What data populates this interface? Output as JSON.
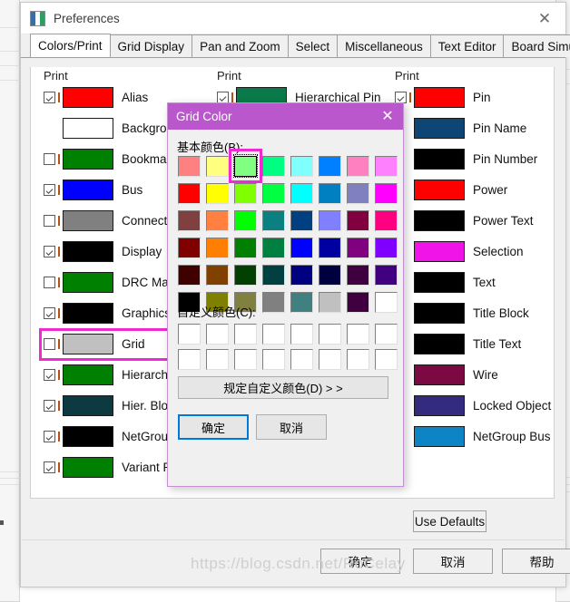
{
  "window": {
    "title": "Preferences",
    "close_label": "✕",
    "app_icon": "app-window-icon"
  },
  "tabs": [
    {
      "label": "Colors/Print",
      "active": true
    },
    {
      "label": "Grid Display",
      "active": false
    },
    {
      "label": "Pan and Zoom",
      "active": false
    },
    {
      "label": "Select",
      "active": false
    },
    {
      "label": "Miscellaneous",
      "active": false
    },
    {
      "label": "Text Editor",
      "active": false
    },
    {
      "label": "Board Simulation",
      "active": false
    }
  ],
  "columns": [
    {
      "header": "Print",
      "rows": [
        {
          "label": "Alias",
          "color": "#fe0000",
          "checked": true,
          "has_checkbox": true,
          "has_tick": true
        },
        {
          "label": "Background",
          "color": "#ffffff",
          "checked": false,
          "has_checkbox": false,
          "has_tick": false
        },
        {
          "label": "Bookmark",
          "color": "#008000",
          "checked": false,
          "has_checkbox": true,
          "has_tick": true
        },
        {
          "label": "Bus",
          "color": "#0000fe",
          "checked": true,
          "has_checkbox": true,
          "has_tick": true
        },
        {
          "label": "Connection S",
          "color": "#808080",
          "checked": false,
          "has_checkbox": true,
          "has_tick": true
        },
        {
          "label": "Display",
          "color": "#000000",
          "checked": true,
          "has_checkbox": true,
          "has_tick": true
        },
        {
          "label": "DRC Marker",
          "color": "#008000",
          "checked": false,
          "has_checkbox": true,
          "has_tick": true
        },
        {
          "label": "Graphics",
          "color": "#000000",
          "checked": true,
          "has_checkbox": true,
          "has_tick": true
        },
        {
          "label": "Grid",
          "color": "#c0c0c0",
          "checked": false,
          "has_checkbox": true,
          "has_tick": true,
          "highlighted": true
        },
        {
          "label": "Hierarchical",
          "color": "#008000",
          "checked": true,
          "has_checkbox": true,
          "has_tick": true
        },
        {
          "label": "Hier. Block N",
          "color": "#0c3a40",
          "checked": true,
          "has_checkbox": true,
          "has_tick": true
        },
        {
          "label": "NetGroup Bl",
          "color": "#000000",
          "checked": true,
          "has_checkbox": true,
          "has_tick": true
        },
        {
          "label": "Variant Part",
          "color": "#008000",
          "checked": true,
          "has_checkbox": true,
          "has_tick": true
        }
      ]
    },
    {
      "header": "Print",
      "rows": [
        {
          "label": "Hierarchical Pin",
          "color": "#0a7a4a",
          "checked": true,
          "has_checkbox": true,
          "has_tick": true
        }
      ]
    },
    {
      "header": "Print",
      "rows": [
        {
          "label": "Pin",
          "color": "#fe0000",
          "checked": true,
          "has_checkbox": true,
          "has_tick": true
        },
        {
          "label": "Pin Name",
          "color": "#0d4574",
          "checked": false,
          "has_checkbox": false,
          "has_tick": false
        },
        {
          "label": "Pin Number",
          "color": "#000000",
          "checked": false,
          "has_checkbox": false,
          "has_tick": false
        },
        {
          "label": "Power",
          "color": "#fe0000",
          "checked": false,
          "has_checkbox": false,
          "has_tick": false
        },
        {
          "label": "Power Text",
          "color": "#000000",
          "checked": false,
          "has_checkbox": false,
          "has_tick": false
        },
        {
          "label": "Selection",
          "color": "#f114e8",
          "checked": false,
          "has_checkbox": false,
          "has_tick": false
        },
        {
          "label": "Text",
          "color": "#000000",
          "checked": false,
          "has_checkbox": false,
          "has_tick": false
        },
        {
          "label": "Title Block",
          "color": "#000000",
          "checked": false,
          "has_checkbox": false,
          "has_tick": false
        },
        {
          "label": "Title Text",
          "color": "#000000",
          "checked": false,
          "has_checkbox": false,
          "has_tick": false
        },
        {
          "label": "Wire",
          "color": "#7b0a42",
          "checked": false,
          "has_checkbox": false,
          "has_tick": false
        },
        {
          "label": "Locked Object",
          "color": "#332b7d",
          "checked": false,
          "has_checkbox": false,
          "has_tick": false
        },
        {
          "label": "NetGroup Bus",
          "color": "#0d84c4",
          "checked": false,
          "has_checkbox": false,
          "has_tick": false
        }
      ]
    }
  ],
  "footer": {
    "use_defaults": "Use Defaults",
    "ok": "确定",
    "cancel": "取消",
    "help": "帮助"
  },
  "color_dialog": {
    "title": "Grid Color",
    "close_label": "✕",
    "basic_label": "基本颜色(B):",
    "custom_label": "自定义颜色(C):",
    "define_button": "规定自定义颜色(D)  > >",
    "ok": "确定",
    "cancel": "取消",
    "selected_index": 2,
    "basic_colors": [
      "#ff8080",
      "#ffff80",
      "#80ff80",
      "#00ff80",
      "#80ffff",
      "#0080ff",
      "#ff80c0",
      "#ff80ff",
      "#ff0000",
      "#ffff00",
      "#80ff00",
      "#00ff40",
      "#00ffff",
      "#0080c0",
      "#8080c0",
      "#ff00ff",
      "#804040",
      "#ff8040",
      "#00ff00",
      "#0c8080",
      "#004080",
      "#8080ff",
      "#800040",
      "#ff0080",
      "#800000",
      "#ff8000",
      "#008000",
      "#008040",
      "#0000ff",
      "#0000a0",
      "#800080",
      "#8000ff",
      "#400000",
      "#804000",
      "#004000",
      "#004040",
      "#000080",
      "#000040",
      "#400040",
      "#400080",
      "#000000",
      "#808000",
      "#808040",
      "#808080",
      "#408080",
      "#c0c0c0",
      "#400040",
      "#ffffff"
    ],
    "custom_colors": [
      "#ffffff",
      "#ffffff",
      "#ffffff",
      "#ffffff",
      "#ffffff",
      "#ffffff",
      "#ffffff",
      "#ffffff",
      "#ffffff",
      "#ffffff",
      "#ffffff",
      "#ffffff",
      "#ffffff",
      "#ffffff",
      "#ffffff",
      "#ffffff"
    ]
  },
  "watermark": "https://blog.csdn.net/RoCelay",
  "accent": {
    "dialog_title_bg": "#bb57cd",
    "highlight_ring": "#ee2bd2",
    "focus_blue": "#0078d7"
  }
}
